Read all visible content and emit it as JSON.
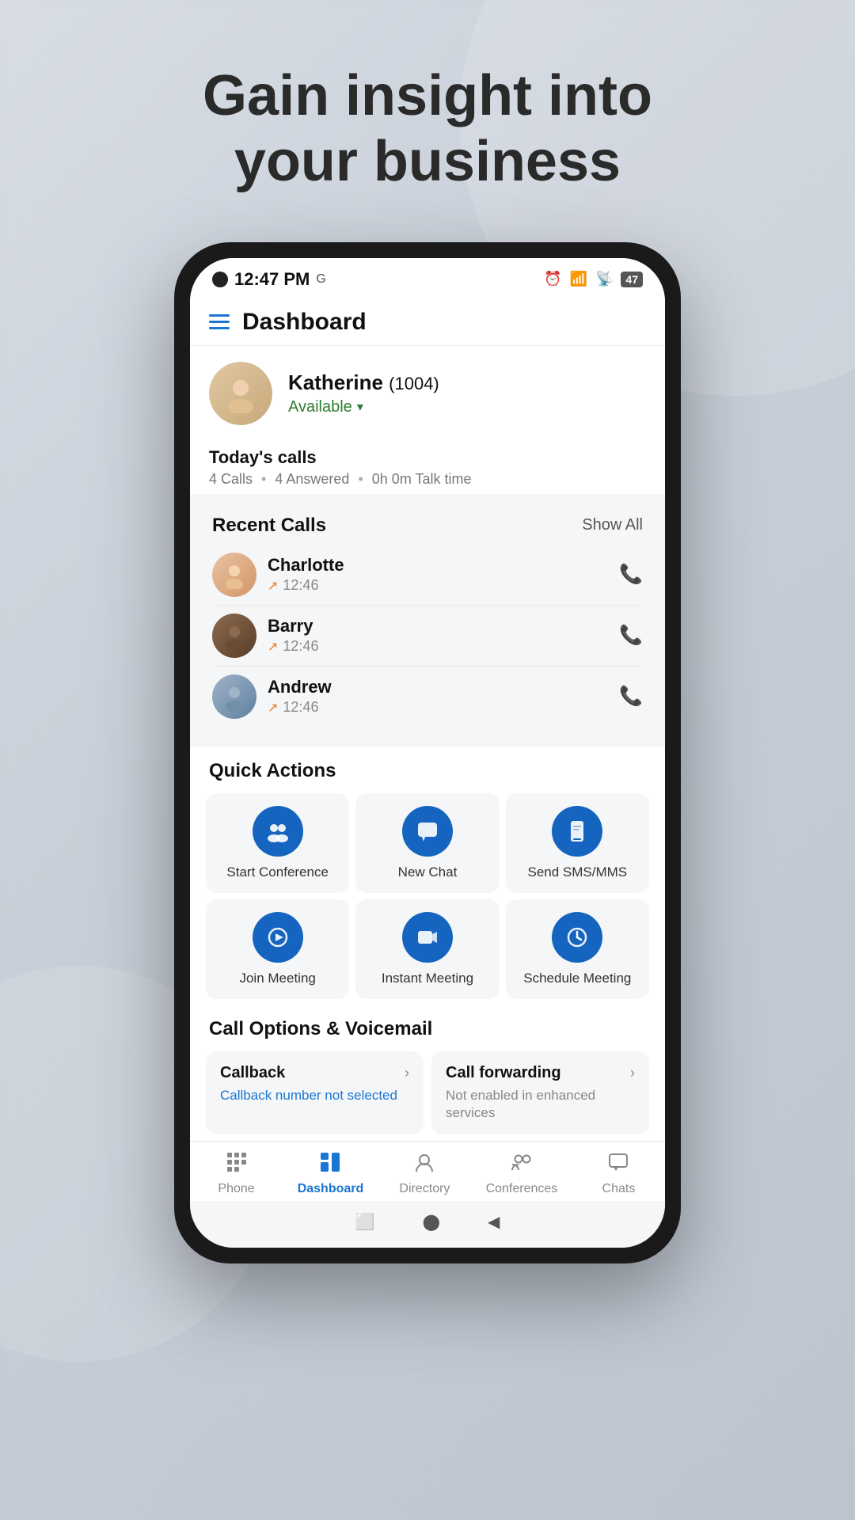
{
  "headline": {
    "line1": "Gain insight into",
    "line2": "your business"
  },
  "phone": {
    "status_bar": {
      "time": "12:47 PM",
      "battery": "47"
    },
    "header": {
      "title": "Dashboard"
    },
    "profile": {
      "name": "Katherine",
      "extension": "(1004)",
      "status": "Available"
    },
    "today_calls": {
      "title": "Today's calls",
      "stats": "4 Calls",
      "answered": "4 Answered",
      "talk_time": "0h 0m Talk time"
    },
    "recent_calls": {
      "title": "Recent Calls",
      "show_all": "Show All",
      "calls": [
        {
          "name": "Charlotte",
          "time": "12:46"
        },
        {
          "name": "Barry",
          "time": "12:46"
        },
        {
          "name": "Andrew",
          "time": "12:46"
        }
      ]
    },
    "quick_actions": {
      "title": "Quick Actions",
      "items": [
        {
          "label": "Start Conference",
          "icon": "👥"
        },
        {
          "label": "New Chat",
          "icon": "💬"
        },
        {
          "label": "Send SMS/MMS",
          "icon": "📱"
        },
        {
          "label": "Join Meeting",
          "icon": "🚪"
        },
        {
          "label": "Instant Meeting",
          "icon": "📹"
        },
        {
          "label": "Schedule Meeting",
          "icon": "🕐"
        }
      ]
    },
    "call_options": {
      "title": "Call Options & Voicemail",
      "items": [
        {
          "title": "Callback",
          "sub": "Callback number not selected",
          "sub_type": "blue"
        },
        {
          "title": "Call forwarding",
          "sub": "Not enabled in enhanced services",
          "sub_type": "gray"
        }
      ]
    },
    "bottom_nav": {
      "items": [
        {
          "label": "Phone",
          "icon": "⠿",
          "active": false
        },
        {
          "label": "Dashboard",
          "icon": "📊",
          "active": true
        },
        {
          "label": "Directory",
          "icon": "👤",
          "active": false
        },
        {
          "label": "Conferences",
          "icon": "👥",
          "active": false
        },
        {
          "label": "Chats",
          "icon": "💬",
          "active": false
        }
      ]
    }
  }
}
